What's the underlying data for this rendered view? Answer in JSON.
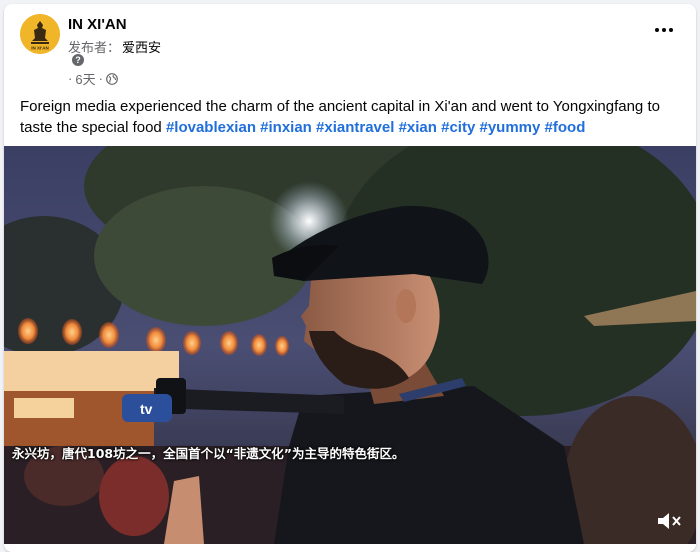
{
  "post": {
    "page_name": "IN XI'AN",
    "publisher_label": "发布者：",
    "publisher_name": "爱西安",
    "help_icon": "?",
    "time_prefix": "·",
    "time_text": "6天",
    "time_sep": "·",
    "privacy_icon": "globe-icon",
    "text": "Foreign media experienced the charm of the ancient capital in Xi'an and went to Yongxingfang to taste the special food",
    "hashtags": [
      "#lovablexian",
      "#inxian",
      "#xiantravel",
      "#xian",
      "#city",
      "#yummy",
      "#food"
    ],
    "avatar_label": "IN XI'AN"
  },
  "video": {
    "subtitle": "永兴坊，唐代108坊之一，全国首个以“非遗文化”为主导的特色街区。",
    "volume_icon": "volume-muted-icon"
  },
  "colors": {
    "link": "#216fdb",
    "secondary_text": "#65676b",
    "avatar_bg": "#f0b528"
  }
}
